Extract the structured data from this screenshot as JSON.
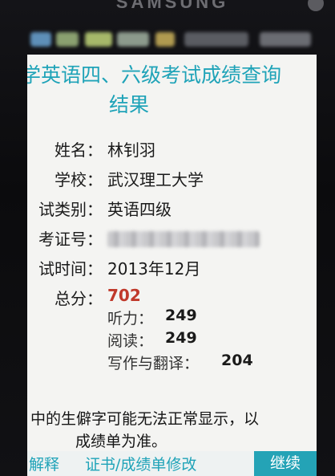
{
  "device": {
    "brand": "SAMSUNG"
  },
  "header": {
    "title_line1": "学英语四、六级考试成绩查询",
    "title_line2": "结果",
    "accent_color": "#1fa3b8"
  },
  "fields": {
    "name_label": "姓名：",
    "name_value": "林钊羽",
    "school_label": "学校：",
    "school_value": "武汉理工大学",
    "exam_type_label": "试类别：",
    "exam_type_value": "英语四级",
    "exam_id_label": "考证号：",
    "exam_time_label": "试时间：",
    "exam_time_value": "2013年12月",
    "total_label": "总分：",
    "total_value": "702",
    "total_color": "#c0392b"
  },
  "scores": {
    "listening_label": "听力：",
    "listening_value": "249",
    "reading_label": "阅读：",
    "reading_value": "249",
    "writing_label": "写作与翻译：",
    "writing_value": "204"
  },
  "notice": {
    "line1": "中的生僻字可能无法正常显示，以",
    "line2": "成绩单为准。"
  },
  "bottom": {
    "link1": "解释",
    "link2": "证书/成绩单修改",
    "continue_label": "继续"
  }
}
